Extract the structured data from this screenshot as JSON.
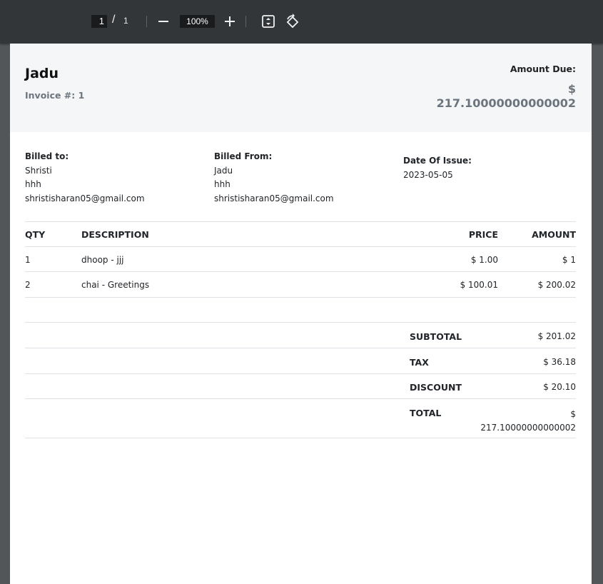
{
  "toolbar": {
    "current_page": "1",
    "page_separator": "/",
    "total_pages": "1",
    "zoom_out_label": "—",
    "zoom_level": "100%",
    "zoom_in_label": "+"
  },
  "invoice": {
    "business_name": "Jadu",
    "invoice_number_label": "Invoice #: 1",
    "amount_due_label": "Amount Due:",
    "amount_due_currency": "$",
    "amount_due_value": "217.10000000000002",
    "billed_to": {
      "label": "Billed to:",
      "name": "Shristi",
      "address": "hhh",
      "email": "shristisharan05@gmail.com"
    },
    "billed_from": {
      "label": "Billed From:",
      "name": "Jadu",
      "address": "hhh",
      "email": "shristisharan05@gmail.com"
    },
    "date_of_issue": {
      "label": "Date Of Issue:",
      "value": "2023-05-05"
    },
    "table": {
      "headers": {
        "qty": "QTY",
        "description": "DESCRIPTION",
        "price": "PRICE",
        "amount": "AMOUNT"
      },
      "rows": [
        {
          "qty": "1",
          "description": "dhoop - jjj",
          "price": "$ 1.00",
          "amount": "$ 1"
        },
        {
          "qty": "2",
          "description": "chai - Greetings",
          "price": "$ 100.01",
          "amount": "$ 200.02"
        }
      ]
    },
    "summary": {
      "subtotal_label": "SUBTOTAL",
      "subtotal_value": "$ 201.02",
      "tax_label": "TAX",
      "tax_value": "$ 36.18",
      "discount_label": "DISCOUNT",
      "discount_value": "$ 20.10",
      "total_label": "TOTAL",
      "total_currency": "$",
      "total_value": "217.10000000000002"
    }
  }
}
